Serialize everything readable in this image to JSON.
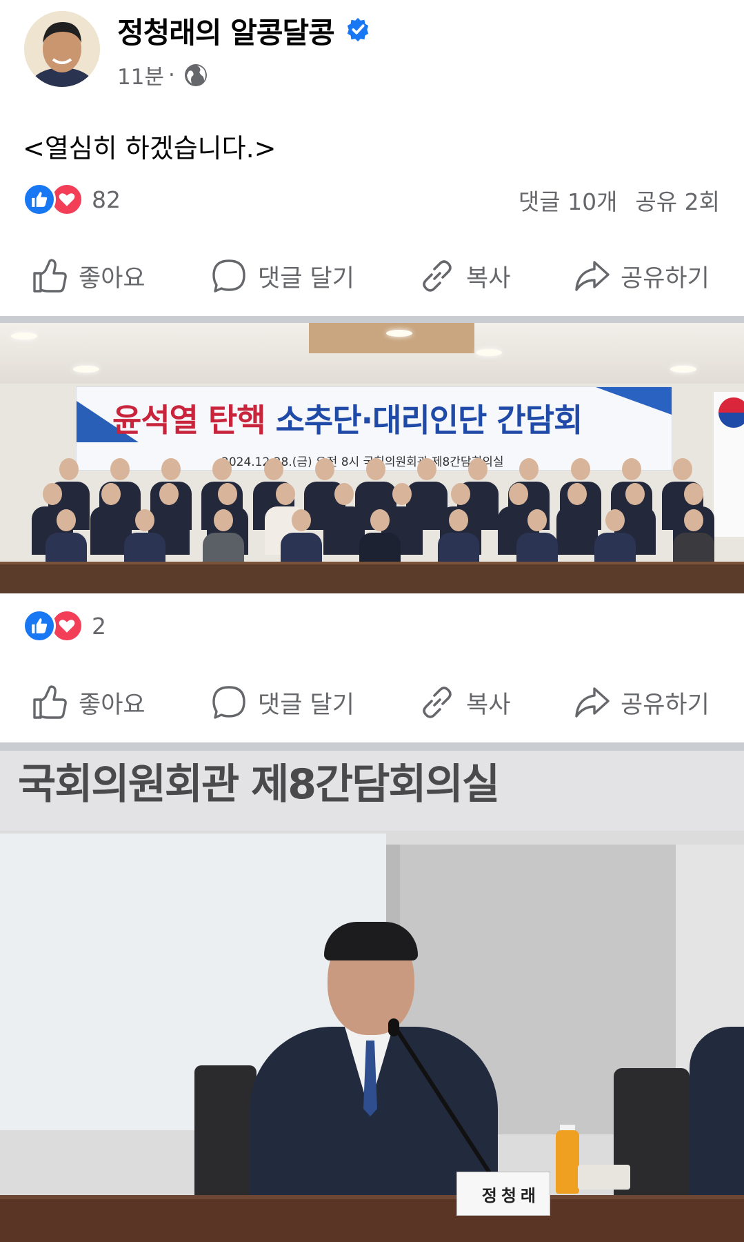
{
  "post": {
    "author_name": "정청래의 알콩달콩",
    "time": "11분",
    "separator": "·",
    "caption": "<열심히 하겠습니다.>",
    "reaction_count": "82",
    "comments_label": "댓글 10개",
    "shares_label": "공유 2회"
  },
  "actions": {
    "like": "좋아요",
    "comment": "댓글 달기",
    "copy": "복사",
    "share": "공유하기"
  },
  "photo1": {
    "banner_red": "윤석열 탄핵",
    "banner_blue": "소추단·대리인단 간담회",
    "banner_sub": "2024.12.28.(금) 오전 8시 국회의원회관 제8간담회의실",
    "reaction_count": "2"
  },
  "photo2": {
    "sign_text": "국회의원회관 제8간담회의실",
    "nameplate": "정청래"
  },
  "colors": {
    "like_blue": "#1877f2",
    "love_red": "#f33e58",
    "verified_blue": "#1877f2",
    "muted_text": "#65676b",
    "divider": "#c9ccd1"
  },
  "icons": [
    "verified-badge-icon",
    "globe-icon",
    "like-reaction-icon",
    "love-reaction-icon",
    "thumbs-up-icon",
    "comment-bubble-icon",
    "link-icon",
    "share-arrow-icon"
  ]
}
